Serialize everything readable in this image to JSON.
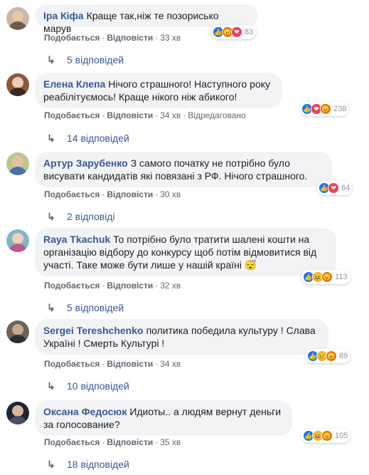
{
  "comments": [
    {
      "author": "Іра Кіфа",
      "text": "Краще так,ніж те позорисько марув",
      "like": "Подобається",
      "reply": "Відповісти",
      "time": "33 хв",
      "edited": "",
      "reactions": [
        "like",
        "angry",
        "love"
      ],
      "reaction_count": "83",
      "replies": "5 відповідей"
    },
    {
      "author": "Елена Клепа",
      "text": "Нічого страшного! Наступного року реабілітуємось! Краще нікого ніж абикого!",
      "like": "Подобається",
      "reply": "Відповісти",
      "time": "34 хв",
      "edited": "Відредаговано",
      "reactions": [
        "like",
        "love",
        "angry"
      ],
      "reaction_count": "238",
      "replies": "14 відповідей"
    },
    {
      "author": "Артур Зарубенко",
      "text": "З самого початку не потрібно було висувати кандидатів які повязані з РФ. Нічого страшного.",
      "like": "Подобається",
      "reply": "Відповісти",
      "time": "30 хв",
      "edited": "",
      "reactions": [
        "like",
        "love"
      ],
      "reaction_count": "64",
      "replies": "2 відповіді"
    },
    {
      "author": "Raya Tkachuk",
      "text": "То потрібно було тратити шалені кошти на організацію відбору до конкурсу щоб потім відмовитися від участі. Таке може бути лише у нашій країні 😴",
      "like": "Подобається",
      "reply": "Відповісти",
      "time": "32 хв",
      "edited": "",
      "reactions": [
        "like",
        "haha",
        "angry"
      ],
      "reaction_count": "113",
      "replies": "5 відповідей"
    },
    {
      "author": "Sergei Tereshchenko",
      "text": "политика победила культуру ! Слава Україні ! Смерть Культурі !",
      "like": "Подобається",
      "reply": "Відповісти",
      "time": "34 хв",
      "edited": "",
      "reactions": [
        "like",
        "sad",
        "angry"
      ],
      "reaction_count": "89",
      "replies": "10 відповідей"
    },
    {
      "author": "Оксана Федосюк",
      "text": "Идиоты.. а людям вернут деньги за голосование?",
      "like": "Подобається",
      "reply": "Відповісти",
      "time": "35 хв",
      "edited": "",
      "reactions": [
        "like",
        "haha",
        "angry"
      ],
      "reaction_count": "105",
      "replies": "18 відповідей"
    }
  ],
  "colors": {
    "link": "#385898",
    "bubble": "#f2f3f5",
    "meta": "#606770",
    "like": "#1877f2",
    "love": "#f33e58",
    "angry": "#e9710f",
    "haha": "#f7b125"
  }
}
